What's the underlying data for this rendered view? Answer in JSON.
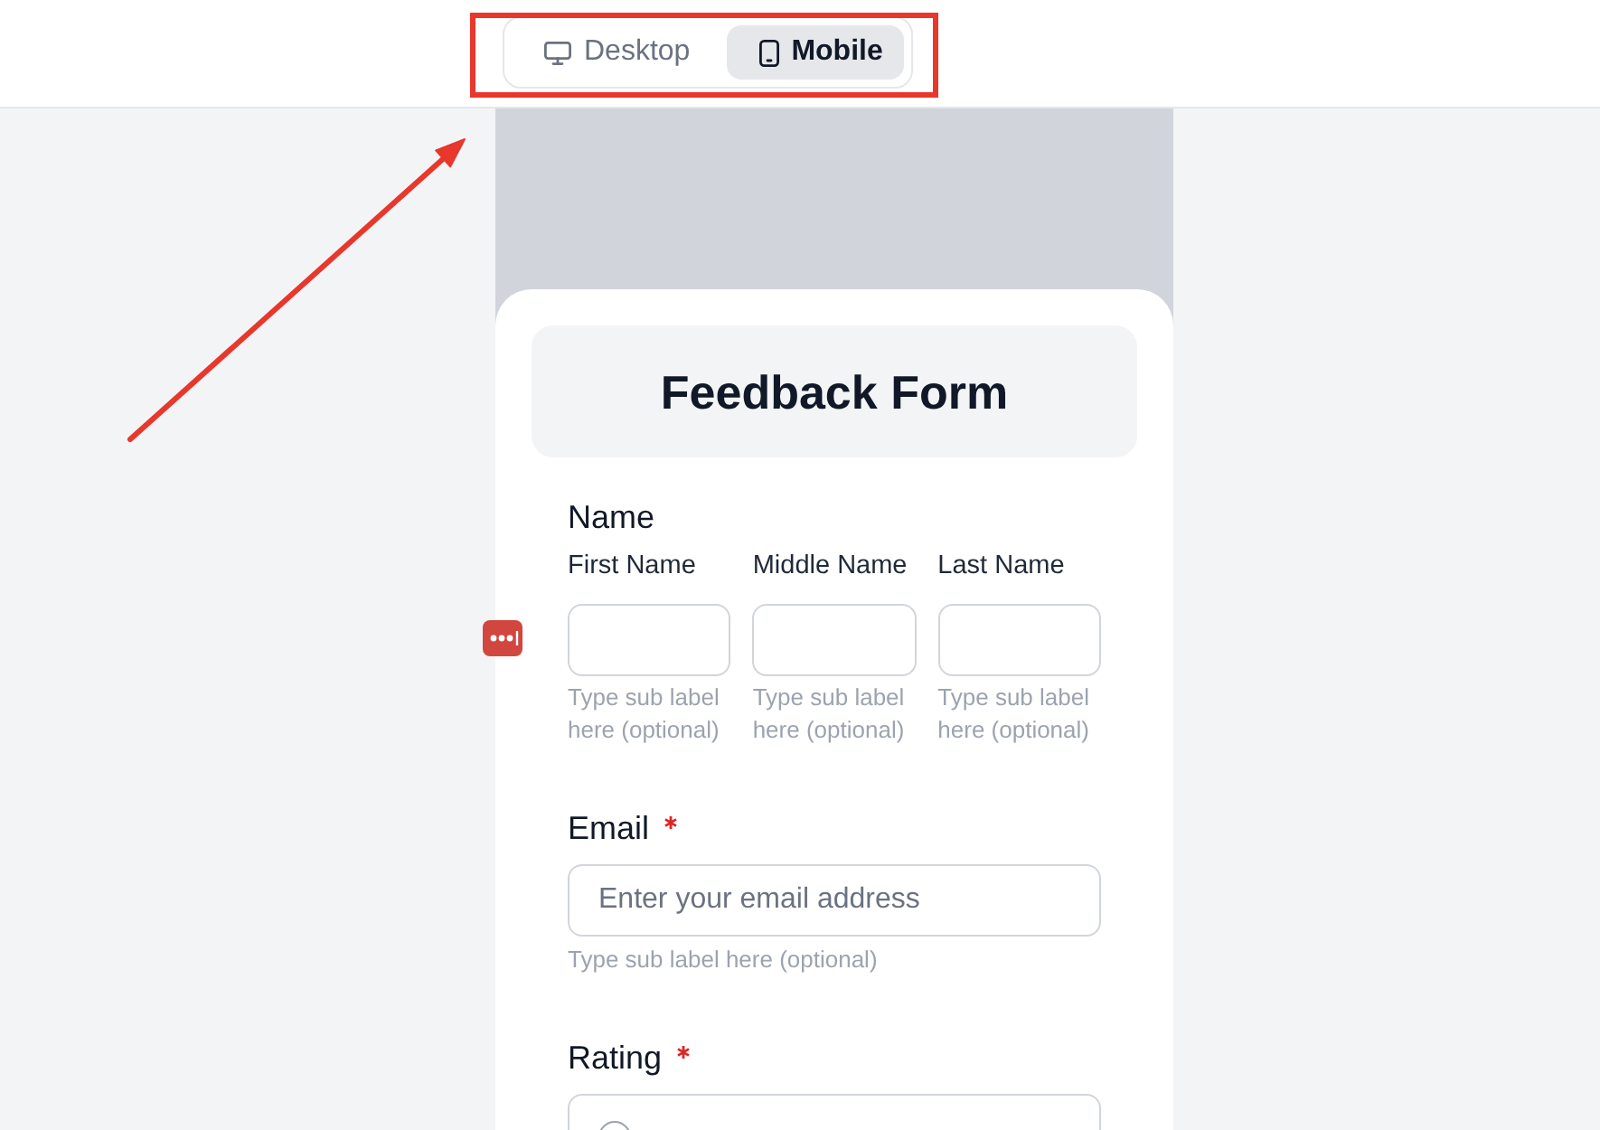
{
  "view_toggle": {
    "options": [
      {
        "kind": "desktop",
        "label": "Desktop",
        "selected": false
      },
      {
        "kind": "mobile",
        "label": "Mobile",
        "selected": true
      }
    ]
  },
  "form": {
    "title": "Feedback Form",
    "fields": [
      {
        "kind": "name",
        "label": "Name",
        "required": false,
        "parts": [
          {
            "label": "First Name",
            "sublabel": "Type sub label here (optional)"
          },
          {
            "label": "Middle Name",
            "sublabel": "Type sub label here (optional)"
          },
          {
            "label": "Last Name",
            "sublabel": "Type sub label here (optional)"
          }
        ]
      },
      {
        "kind": "email",
        "label": "Email",
        "required": true,
        "placeholder": "Enter your email address",
        "sublabel": "Type sub label here (optional)"
      },
      {
        "kind": "radio",
        "label": "Rating",
        "required": true,
        "options": [
          {
            "selected": false
          }
        ]
      }
    ]
  }
}
